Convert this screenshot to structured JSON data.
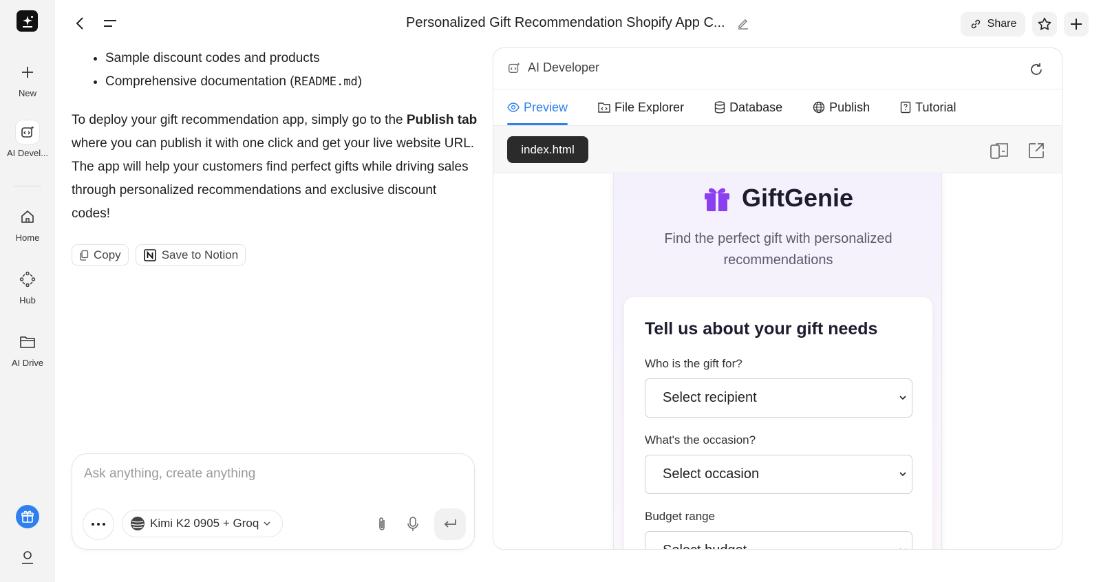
{
  "rail": {
    "items": [
      {
        "label": "New"
      },
      {
        "label": "AI Devel..."
      },
      {
        "label": "Home"
      },
      {
        "label": "Hub"
      },
      {
        "label": "AI Drive"
      }
    ]
  },
  "topbar": {
    "title": "Personalized Gift Recommendation Shopify App C...",
    "share_label": "Share"
  },
  "chat": {
    "bullets": [
      {
        "text": "Sample discount codes and products"
      },
      {
        "pre": "Comprehensive documentation (",
        "code": "README.md",
        "post": ")"
      }
    ],
    "para_pre": "To deploy your gift recommendation app, simply go to the ",
    "para_bold": "Publish tab",
    "para_post": " where you can publish it with one click and get your live website URL. The app will help your customers find perfect gifts while driving sales through personalized recommendations and exclusive discount codes!",
    "copy_label": "Copy",
    "notion_label": "Save to Notion"
  },
  "composer": {
    "placeholder": "Ask anything, create anything",
    "model": "Kimi K2 0905 + Groq"
  },
  "panel": {
    "title": "AI Developer",
    "tabs": [
      {
        "label": "Preview"
      },
      {
        "label": "File Explorer"
      },
      {
        "label": "Database"
      },
      {
        "label": "Publish"
      },
      {
        "label": "Tutorial"
      }
    ],
    "file": "index.html"
  },
  "app": {
    "brand": "GiftGenie",
    "tagline": "Find the perfect gift with personalized recommendations",
    "form_title": "Tell us about your gift needs",
    "fields": [
      {
        "label": "Who is the gift for?",
        "value": "Select recipient"
      },
      {
        "label": "What's the occasion?",
        "value": "Select occasion"
      },
      {
        "label": "Budget range",
        "value": "Select budget"
      }
    ]
  },
  "colors": {
    "accent": "#2f80ed",
    "brand_purple": "#8b3ff0"
  }
}
